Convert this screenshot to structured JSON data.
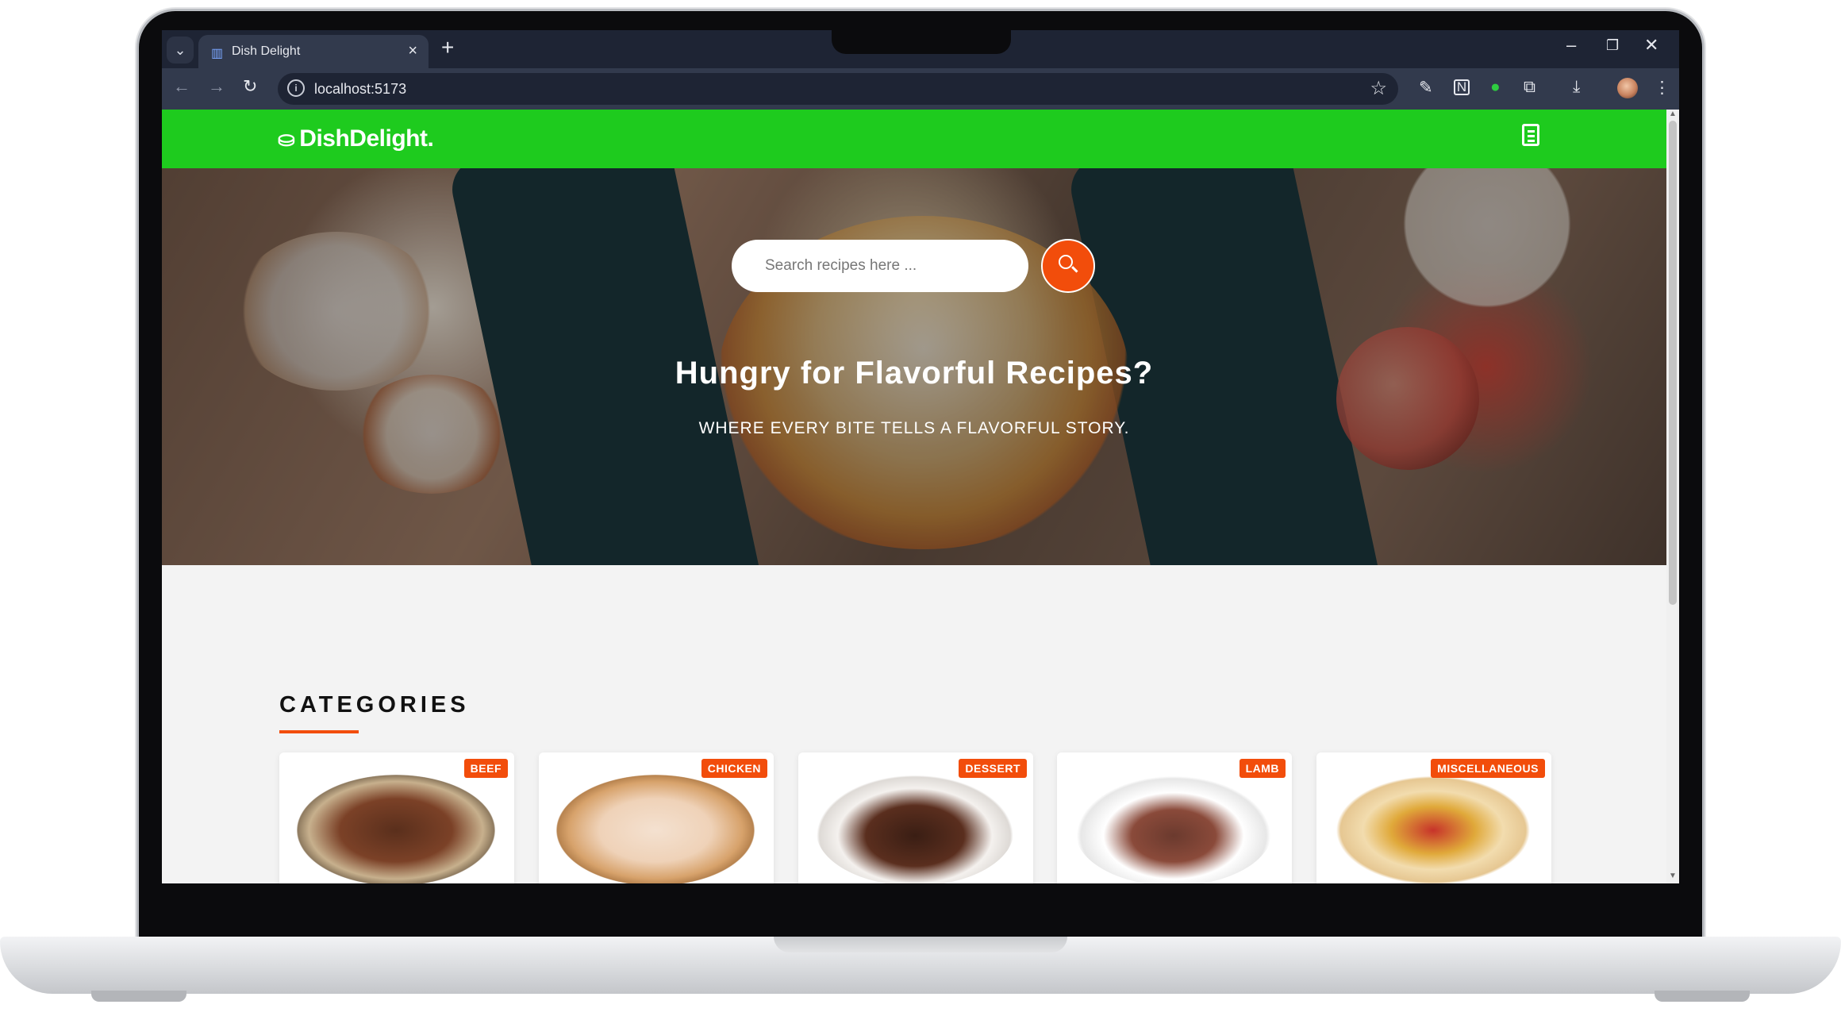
{
  "browser": {
    "tab_title": "Dish Delight",
    "url": "localhost:5173",
    "new_tab": "+",
    "close_tab": "×"
  },
  "site": {
    "brand": "DishDelight.",
    "hero": {
      "search_placeholder": "Search recipes here ...",
      "title": "Hungry for Flavorful Recipes?",
      "subtitle": "WHERE EVERY BITE TELLS A FLAVORFUL STORY."
    },
    "categories": {
      "heading": "CATEGORIES",
      "items": [
        {
          "label": "BEEF",
          "icon": "beef-steak-image"
        },
        {
          "label": "CHICKEN",
          "icon": "chicken-legs-image"
        },
        {
          "label": "DESSERT",
          "icon": "chocolate-cake-image"
        },
        {
          "label": "LAMB",
          "icon": "lamb-chops-image"
        },
        {
          "label": "MISCELLANEOUS",
          "icon": "tacos-image"
        }
      ]
    }
  },
  "colors": {
    "navbar": "#1ecb1e",
    "accent": "#f24d0b",
    "chrome_dark": "#1e2434",
    "chrome_toolbar": "#323a4d"
  }
}
